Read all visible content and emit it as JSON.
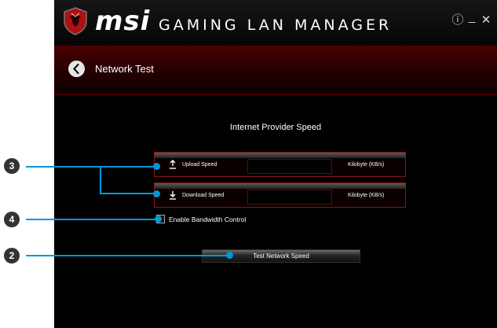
{
  "app": {
    "brand": "msi",
    "product": "GAMING LAN MANAGER",
    "window_controls": {
      "info": "ⓘ",
      "minimize": "_",
      "close": "✕"
    }
  },
  "subheader": {
    "title": "Network Test"
  },
  "main": {
    "section_title": "Internet Provider Speed",
    "upload": {
      "label": "Upload Speed",
      "value": "",
      "unit": "Kilobyte (KB/s)"
    },
    "download": {
      "label": "Download Speed",
      "value": "",
      "unit": "Kilobyte (KB/s)"
    },
    "bandwidth_control": {
      "label": "Enable Bandwidth Control",
      "checked": false
    },
    "test_button": "Test Network Speed"
  },
  "callouts": {
    "badge_3": "3",
    "badge_4": "4",
    "badge_2": "2"
  },
  "colors": {
    "accent_blue": "#0098d8",
    "msi_red": "#8a1414",
    "background": "#000000"
  }
}
